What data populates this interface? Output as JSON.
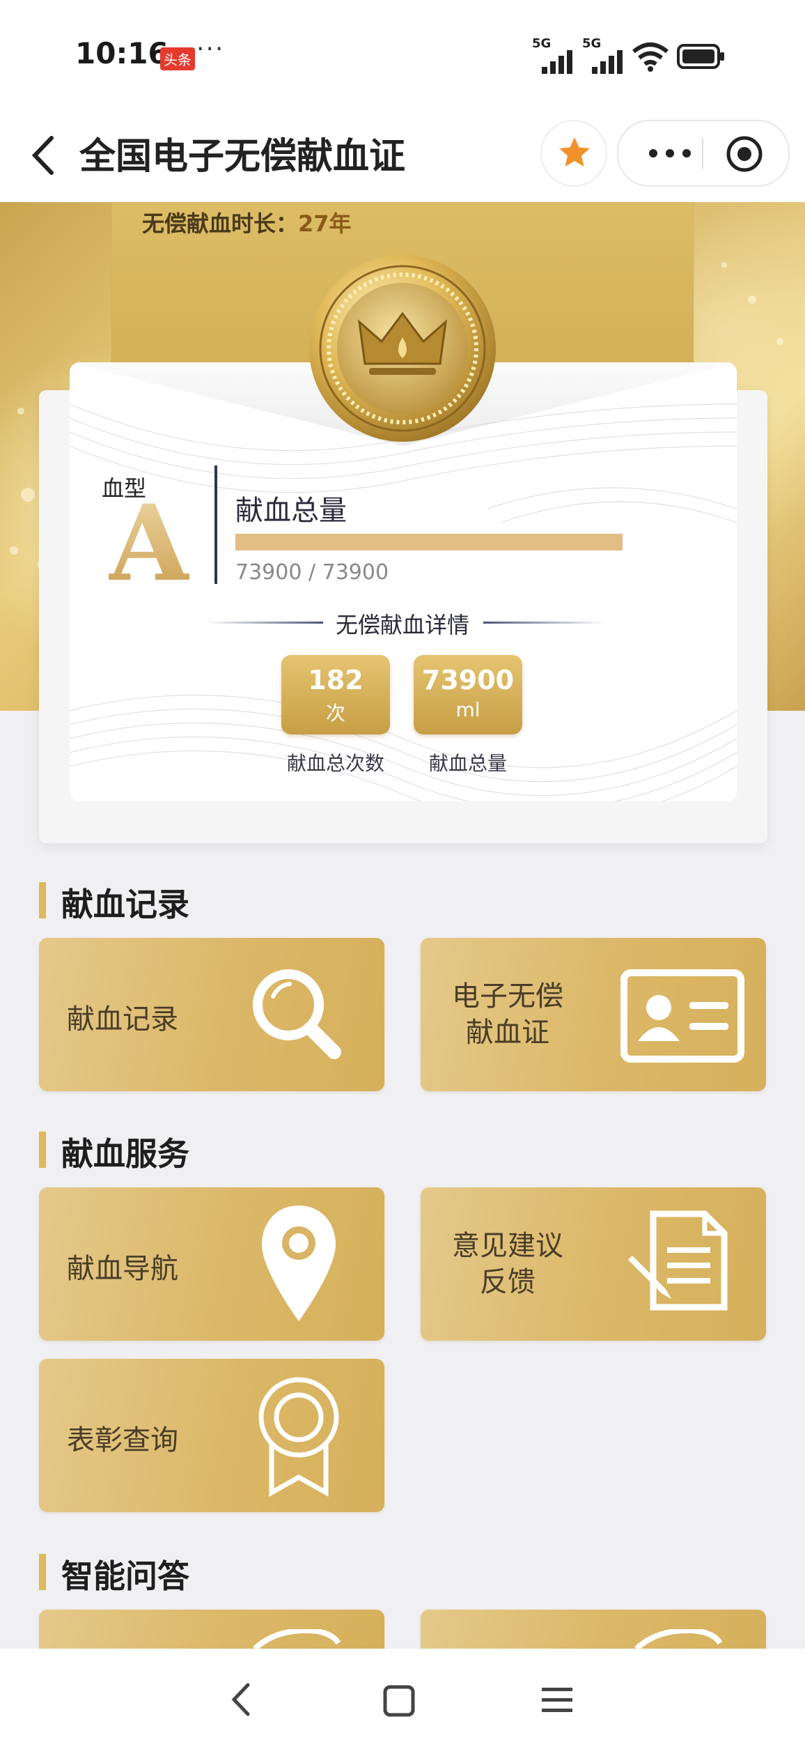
{
  "status_bar": {
    "time": "10:16",
    "badge": "头条",
    "more": "···",
    "signal_1": "5G",
    "signal_2": "5G"
  },
  "header": {
    "title": "全国电子无偿献血证",
    "icons": [
      "back-icon",
      "star-icon",
      "more-icon",
      "target-icon"
    ]
  },
  "card": {
    "duration_label": "无偿献血时长：",
    "duration_value": "27年",
    "blood_type_label": "血型",
    "blood_type": "A",
    "total_label": "献血总量",
    "progress_text": "73900 / 73900",
    "progress_fraction": 1.0,
    "details_title": "无偿献血详情",
    "stats": [
      {
        "value": "182",
        "unit": "次",
        "label": "献血总次数"
      },
      {
        "value": "73900",
        "unit": "ml",
        "label": "献血总量"
      }
    ]
  },
  "sections": [
    {
      "title": "献血记录",
      "tiles": [
        {
          "label": "献血记录",
          "icon": "search-icon"
        },
        {
          "label_line1": "电子无偿",
          "label_line2": "献血证",
          "icon": "id-card-icon"
        }
      ]
    },
    {
      "title": "献血服务",
      "tiles": [
        {
          "label": "献血导航",
          "icon": "location-pin-icon"
        },
        {
          "label_line1": "意见建议",
          "label_line2": "反馈",
          "icon": "feedback-document-icon"
        },
        {
          "label": "表彰查询",
          "icon": "award-ribbon-icon"
        }
      ]
    },
    {
      "title": "智能问答",
      "tiles": []
    }
  ],
  "colors": {
    "gold_light": "#e5c98a",
    "gold_dark": "#c79e45",
    "accent_star": "#f0922b",
    "page_bg": "#f0eff1"
  }
}
